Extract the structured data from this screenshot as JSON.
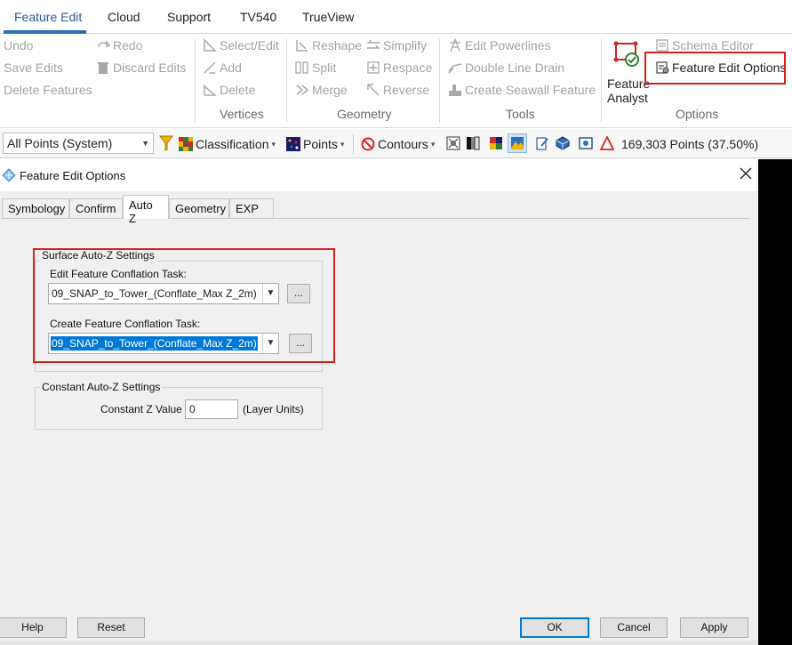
{
  "ribbon": {
    "tabs": [
      {
        "label": "Feature Edit",
        "active": true
      },
      {
        "label": "Cloud"
      },
      {
        "label": "Support"
      },
      {
        "label": "TV540"
      },
      {
        "label": "TrueView"
      }
    ],
    "groups": {
      "edit": {
        "undo": "Undo",
        "save_edits": "Save Edits",
        "delete_features": "Delete Features",
        "redo": "Redo",
        "discard_edits": "Discard Edits"
      },
      "vertices": {
        "title": "Vertices",
        "select_edit": "Select/Edit",
        "add": "Add",
        "delete": "Delete"
      },
      "geometry": {
        "title": "Geometry",
        "reshape": "Reshape",
        "split": "Split",
        "merge": "Merge",
        "simplify": "Simplify",
        "respace": "Respace",
        "reverse": "Reverse"
      },
      "tools": {
        "title": "Tools",
        "edit_powerlines": "Edit Powerlines",
        "double_line_drain": "Double Line Drain",
        "create_seawall_feature": "Create Seawall Feature"
      },
      "options": {
        "title": "Options",
        "feature_analyst": "Feature Analyst",
        "schema_editor": "Schema Editor",
        "feature_edit_options": "Feature Edit Options"
      }
    }
  },
  "toolbar": {
    "point_filter": "All Points (System)",
    "classification": "Classification",
    "points": "Points",
    "contours": "Contours",
    "status": "169,303 Points (37.50%)"
  },
  "dialog": {
    "title": "Feature Edit Options",
    "tabs": [
      {
        "label": "Symbology"
      },
      {
        "label": "Confirm"
      },
      {
        "label": "Auto Z",
        "active": true
      },
      {
        "label": "Geometry"
      },
      {
        "label": "EXP"
      }
    ],
    "surface_group": {
      "title": "Surface Auto-Z Settings",
      "edit_label": "Edit Feature Conflation Task:",
      "edit_value": "09_SNAP_to_Tower_(Conflate_Max Z_2m)",
      "create_label": "Create Feature Conflation Task:",
      "create_value": "09_SNAP_to_Tower_(Conflate_Max Z_2m)",
      "browse": "..."
    },
    "constant_group": {
      "title": "Constant Auto-Z Settings",
      "value_label": "Constant Z Value",
      "value": "0",
      "units": "(Layer Units)"
    },
    "buttons": {
      "help": "Help",
      "reset": "Reset",
      "ok": "OK",
      "cancel": "Cancel",
      "apply": "Apply"
    }
  },
  "colors": {
    "accent": "#2b6fbf",
    "highlight": "#d81e1e",
    "selection": "#0078d7"
  }
}
